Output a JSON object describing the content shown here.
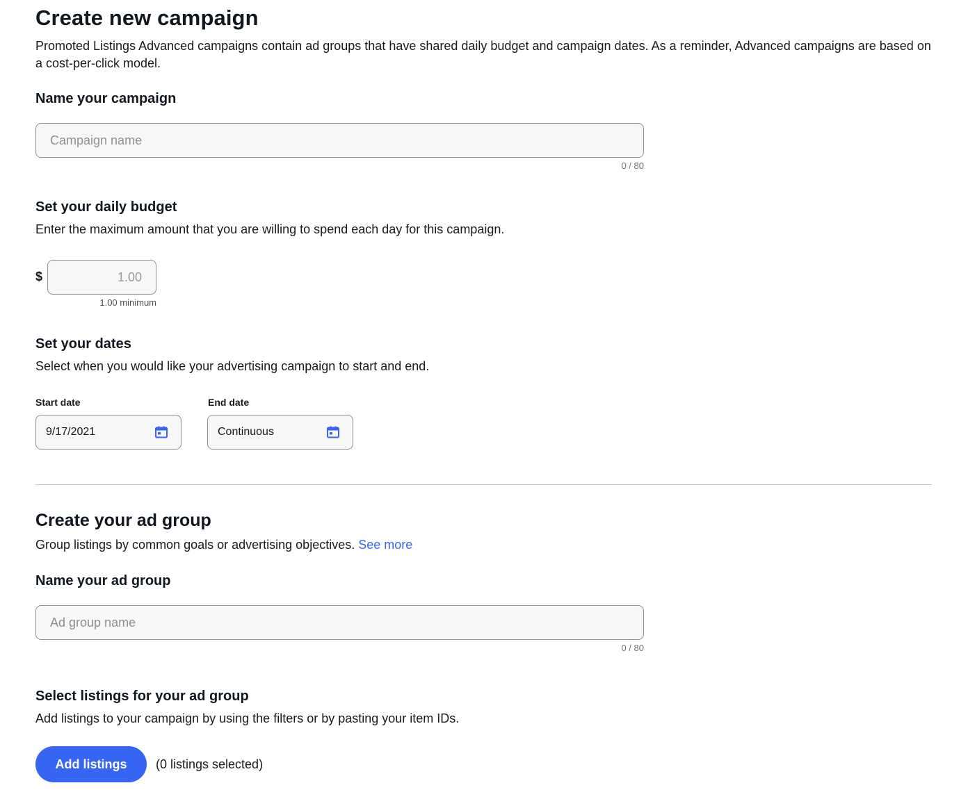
{
  "page": {
    "title": "Create new campaign",
    "intro": "Promoted Listings Advanced campaigns contain ad groups that have shared daily budget and campaign dates. As a reminder, Advanced campaigns are based on a cost-per-click model."
  },
  "campaign_name": {
    "heading": "Name your campaign",
    "placeholder": "Campaign name",
    "value": "",
    "counter": "0 / 80"
  },
  "budget": {
    "heading": "Set your daily budget",
    "description": "Enter the maximum amount that you are willing to spend each day for this campaign.",
    "currency": "$",
    "placeholder": "1.00",
    "hint": "1.00 minimum"
  },
  "dates": {
    "heading": "Set your dates",
    "description": "Select when you would like your advertising campaign to start and end.",
    "start_label": "Start date",
    "start_value": "9/17/2021",
    "end_label": "End date",
    "end_value": "Continuous"
  },
  "ad_group": {
    "heading": "Create your ad group",
    "description": "Group listings by common goals or advertising objectives.",
    "see_more": "See more",
    "name_heading": "Name your ad group",
    "placeholder": "Ad group name",
    "counter": "0 / 80"
  },
  "listings": {
    "heading": "Select listings for your ad group",
    "description": "Add listings to your campaign by using the filters or by pasting your item IDs.",
    "button_label": "Add listings",
    "selected_text": "(0 listings selected)"
  },
  "colors": {
    "accent": "#3665f3",
    "text": "#191919",
    "border": "#8f8f8f",
    "field_bg": "#f7f7f7"
  },
  "icons": {
    "calendar": "calendar-icon"
  }
}
